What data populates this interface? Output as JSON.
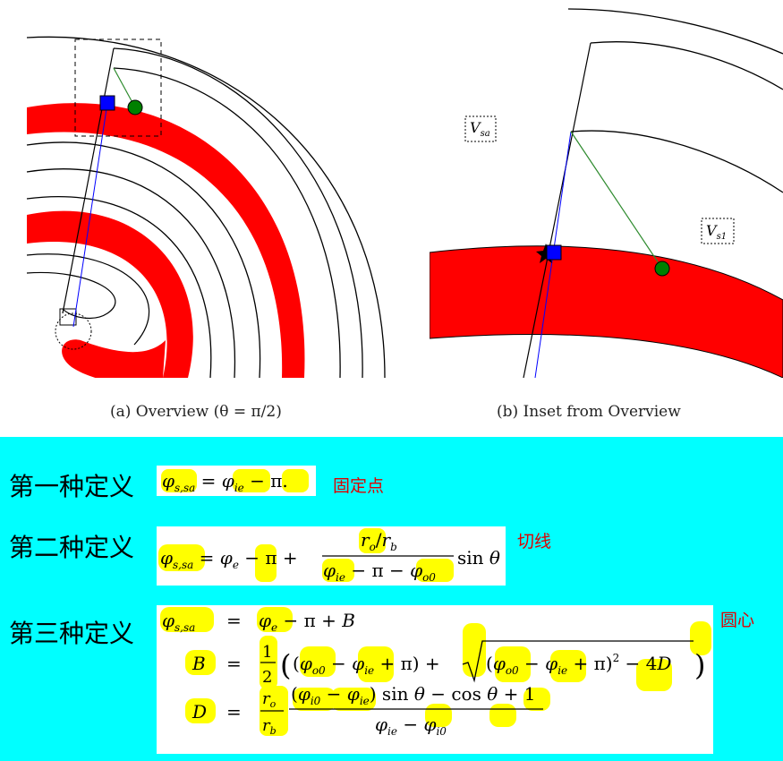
{
  "figure": {
    "caption_a": "(a) Overview (θ = π/2)",
    "caption_b": "(b) Inset from Overview",
    "label_vsa": "V",
    "label_vsa_sub": "sa",
    "label_vs1": "V",
    "label_vs1_sub": "s1",
    "colors": {
      "scroll": "#ff0000",
      "point_square": "#0000ff",
      "point_circle": "#008000",
      "line_green": "#2e8b2e",
      "line_blue": "#0000ff"
    }
  },
  "definitions": {
    "def1": {
      "label": "第一种定义",
      "note": "固定点"
    },
    "def2": {
      "label": "第二种定义",
      "note": "切线"
    },
    "def3": {
      "label": "第三种定义",
      "note": "圆心"
    }
  },
  "colors": {
    "background": "#00ffff",
    "highlight": "#ffff00",
    "note": "#e00000"
  }
}
